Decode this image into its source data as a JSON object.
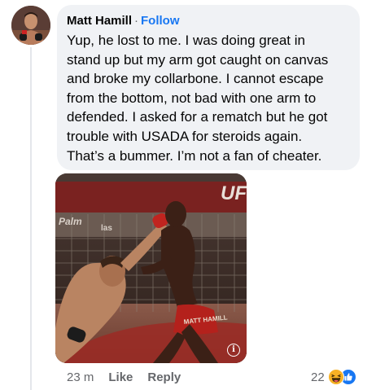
{
  "comment": {
    "author": "Matt Hamill",
    "separator": "·",
    "follow_label": "Follow",
    "text": "Yup, he lost to me. I was doing great in\nstand up but my arm got caught on canvas\nand broke my collarbone. I cannot escape\nfrom the bottom, not bad with one arm to\ndefended. I asked for a rematch but he got\ntrouble with USADA for steroids again.\nThat’s a bummer. I’m not a fan of cheater."
  },
  "photo": {
    "banner_text": "UF",
    "sponsor_text": "Palm",
    "sponsor_text_2": "las",
    "shorts_text": "MATT HAMILL"
  },
  "actions": {
    "time": "23 m",
    "like_label": "Like",
    "reply_label": "Reply"
  },
  "reactions": {
    "count": "22",
    "icons": [
      "haha-reaction-icon",
      "like-reaction-icon"
    ]
  },
  "colors": {
    "link": "#1877f2",
    "bubble": "#f0f2f5",
    "muted": "#65676b",
    "text": "#050505"
  }
}
